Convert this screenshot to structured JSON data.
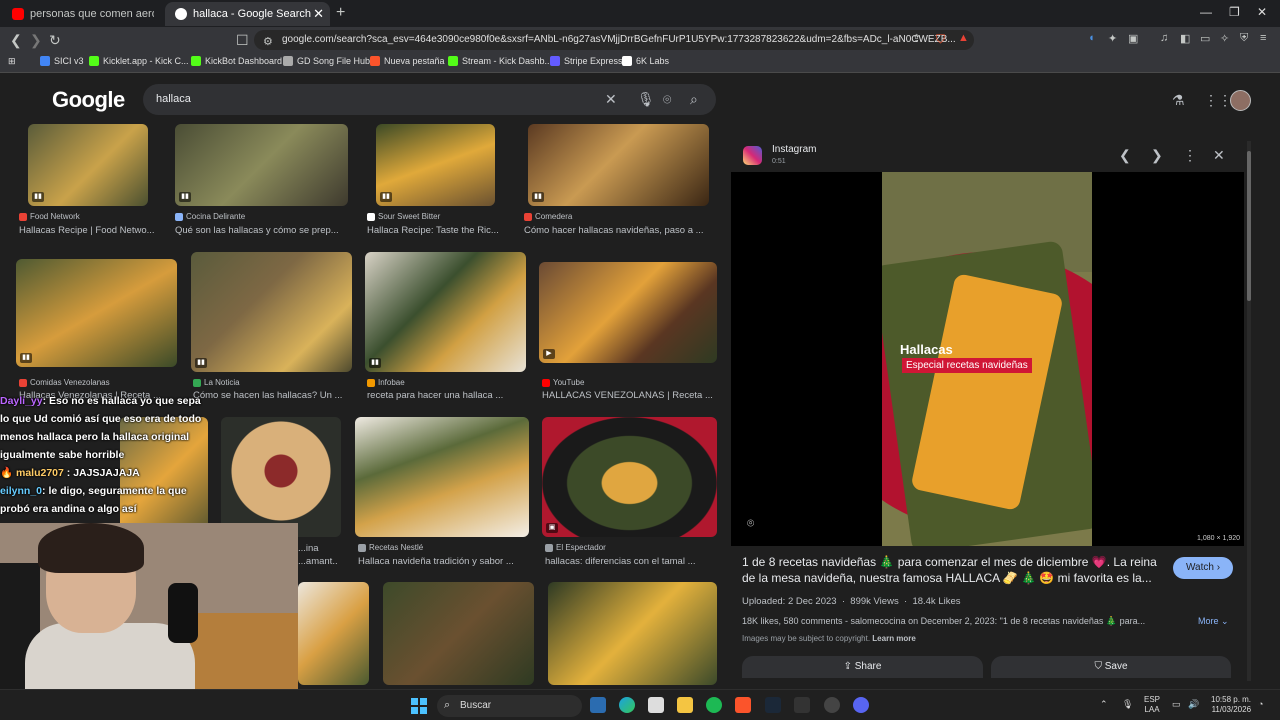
{
  "browser": {
    "tabs": [
      {
        "title": "personas que comen aerosol - YouTu",
        "active": false
      },
      {
        "title": "hallaca - Google Search",
        "active": true
      }
    ],
    "url": "google.com/search?sca_esv=464e3090ce980f0e&sxsrf=ANbL-n6g27asVMjjDrrBGefnFUrP1U5YPw:1773287823622&udm=2&fbs=ADc_l-aN0CWEZB...",
    "bookmarks": [
      "SICI v3",
      "Kicklet.app - Kick C...",
      "KickBot Dashboard",
      "GD Song File Hub",
      "Nueva pestaña",
      "Stream - Kick Dashb...",
      "Stripe Express",
      "6K Labs"
    ]
  },
  "google": {
    "logo": "Google",
    "query": "hallaca"
  },
  "results": [
    {
      "source": "Food Network",
      "title": "Hallacas Recipe | Food Netwo...",
      "color": "#e94235"
    },
    {
      "source": "Cocina Delirante",
      "title": "Qué son las hallacas y cómo se prep...",
      "color": "#8ab4f8"
    },
    {
      "source": "Sour Sweet Bitter",
      "title": "Hallaca Recipe: Taste the Ric...",
      "color": "#ffffff"
    },
    {
      "source": "Comedera",
      "title": "Cómo hacer hallacas navideñas, paso a ...",
      "color": "#e94235"
    },
    {
      "source": "Comidas Venezolanas",
      "title": "Hallacas Venezolanas | Receta ...",
      "color": "#e94235"
    },
    {
      "source": "La Noticia",
      "title": "Cómo se hacen las hallacas? Un ...",
      "color": "#34a853"
    },
    {
      "source": "Infobae",
      "title": "receta para hacer una hallaca ...",
      "color": "#f29900"
    },
    {
      "source": "YouTube",
      "title": "HALLACAS VENEZOLANAS | Receta ...",
      "color": "#ff0000"
    },
    {
      "source": "...ina",
      "title": "...amant...",
      "color": "#888888"
    },
    {
      "source": "Recetas Nestlé",
      "title": "Hallaca navideña tradición y sabor ...",
      "color": "#9aa0a6"
    },
    {
      "source": "El Espectador",
      "title": "hallacas: diferencias con el tamal ...",
      "color": "#9aa0a6"
    }
  ],
  "panel": {
    "site": "Instagram",
    "duration": "0:51",
    "image_title": "Hallacas",
    "image_banner": "Especial recetas navideñas",
    "dimensions": "1,080 × 1,920",
    "description": "1 de 8 recetas navideñas 🎄 para comenzar el mes de diciembre 💗. La reina de la mesa navideña, nuestra famosa HALLACA 🫔 🎄 🤩 mi favorita es la...",
    "watch_label": "Watch",
    "uploaded": "Uploaded: 2 Dec 2023",
    "views": "899k Views",
    "likes": "18.4k Likes",
    "comments": "18K likes, 580 comments - salomecocina on December 2, 2023: \"1 de 8 recetas navideñas 🎄 para...",
    "more_label": "More",
    "copyright": "Images may be subject to copyright.",
    "learn_more": "Learn more",
    "share_label": "Share",
    "save_label": "Save"
  },
  "chat": [
    {
      "user": "Dayli_yy",
      "text": ": Eso no es hallaca yo que sepa lo que Ud comió así que eso era de todo menos hallaca pero la hallaca original igualmente sabe horrible"
    },
    {
      "user": "malu2707",
      "text": " : JAJSJAJAJA"
    },
    {
      "user": "eilynn_0",
      "text": ": le digo, seguramente la que probó era andina o algo así"
    }
  ],
  "taskbar": {
    "search": "Buscar",
    "lang_top": "ESP",
    "lang_bottom": "LAA",
    "time": "10:58 p. m.",
    "date": "11/03/2026"
  }
}
